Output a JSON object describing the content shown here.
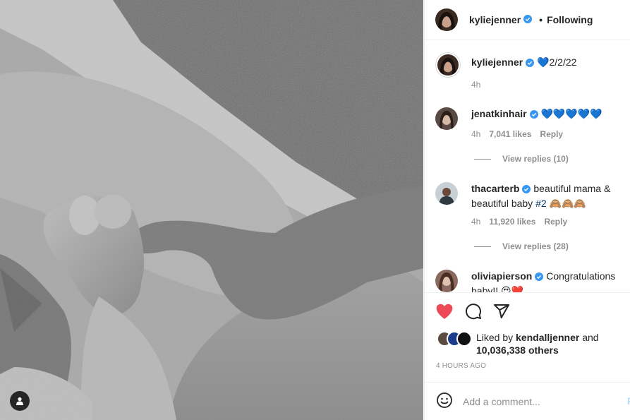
{
  "post": {
    "author": "kyliejenner",
    "follow_state": "Following",
    "caption": {
      "username": "kyliejenner",
      "text": "💙2/2/22",
      "time": "4h"
    }
  },
  "comments": [
    {
      "username": "jenatkinhair",
      "text": "💙💙💙💙💙",
      "time": "4h",
      "likes": "7,041 likes",
      "reply": "Reply",
      "view_replies": "View replies (10)"
    },
    {
      "username": "thacarterb",
      "text": "beautiful mama & beautiful baby ",
      "hashtag": "#2",
      "emoji": " 🙈🙈🙈",
      "time": "4h",
      "likes": "11,920 likes",
      "reply": "Reply",
      "view_replies": "View replies (28)"
    },
    {
      "username": "oliviapierson",
      "text": "Congratulations baby!! 😍❤️"
    }
  ],
  "likes": {
    "prefix": "Liked by ",
    "user": "kendalljenner",
    "middle": " and",
    "others": "10,036,338 others"
  },
  "time_ago": "4 HOURS AGO",
  "comment_box": {
    "placeholder": "Add a comment...",
    "post_label": "Post"
  },
  "icons": {
    "heart": "heart-filled-icon",
    "comment": "comment-icon",
    "share": "share-icon",
    "emoji": "emoji-icon",
    "tag": "user-tag-icon"
  },
  "colors": {
    "like": "#ed4956",
    "verified": "#3897f0",
    "post_disabled": "#b2dffc"
  }
}
